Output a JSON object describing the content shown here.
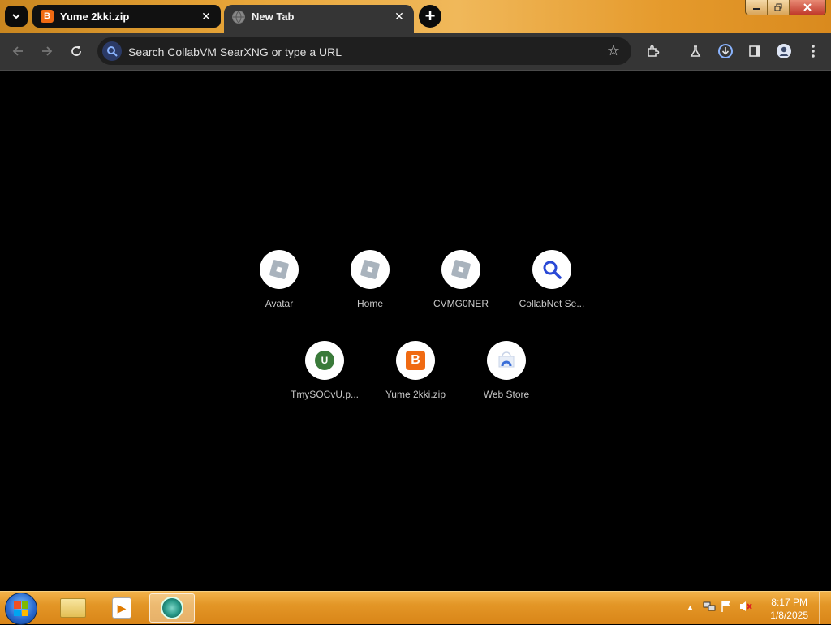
{
  "browser": {
    "tabs": [
      {
        "title": "Yume 2kki.zip",
        "favicon": "B",
        "active": false
      },
      {
        "title": "New Tab",
        "favicon": "globe-icon",
        "active": true
      }
    ],
    "tab_close": "✕",
    "new_tab_symbol": "+",
    "omnibox": {
      "placeholder": "Search CollabVM SearXNG or type a URL",
      "value": ""
    }
  },
  "shortcuts": [
    {
      "label": "Avatar",
      "icon": "roblox-icon"
    },
    {
      "label": "Home",
      "icon": "roblox-icon"
    },
    {
      "label": "CVMG0NER",
      "icon": "roblox-icon"
    },
    {
      "label": "CollabNet Se...",
      "icon": "search-icon"
    },
    {
      "label": "TmySOCvU.p...",
      "icon": "U"
    },
    {
      "label": "Yume 2kki.zip",
      "icon": "B"
    },
    {
      "label": "Web Store",
      "icon": "web-store-icon"
    }
  ],
  "taskbar": {
    "clock_time": "8:17 PM",
    "clock_date": "1/8/2025",
    "tray_arrow": "▲"
  },
  "colors": {
    "tab_strip": "#e8a63a",
    "toolbar": "#353535",
    "content_bg": "#000000",
    "taskbar": "#e39626",
    "brand_orange": "#f06a12"
  }
}
